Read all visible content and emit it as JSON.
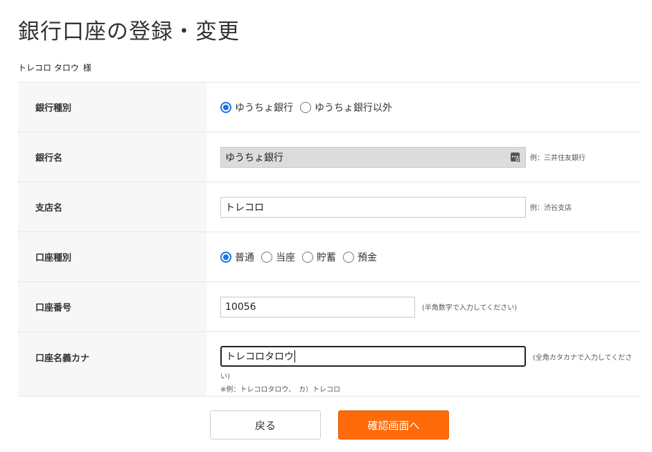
{
  "page": {
    "title": "銀行口座の登録・変更",
    "user_name": "トレコロ タロウ",
    "honorific": "様"
  },
  "form": {
    "bank_type": {
      "label": "銀行種別",
      "options": [
        {
          "label": "ゆうちょ銀行",
          "checked": true
        },
        {
          "label": "ゆうちょ銀行以外",
          "checked": false
        }
      ]
    },
    "bank_name": {
      "label": "銀行名",
      "value": "ゆうちょ銀行",
      "hint": "例：三井住友銀行",
      "icon": "calculator-icon"
    },
    "branch_name": {
      "label": "支店名",
      "value": "トレコロ",
      "hint": "例：渋谷支店"
    },
    "account_type": {
      "label": "口座種別",
      "options": [
        {
          "label": "普通",
          "checked": true
        },
        {
          "label": "当座",
          "checked": false
        },
        {
          "label": "貯蓄",
          "checked": false
        },
        {
          "label": "預金",
          "checked": false
        }
      ]
    },
    "account_number": {
      "label": "口座番号",
      "value": "10056",
      "hint": "(半角数字で入力してください)"
    },
    "account_holder_kana": {
      "label": "口座名義カナ",
      "value": "トレコロタロウ",
      "hint_line1": "(全角カタカナで入力してくださ",
      "hint_line2": "い)",
      "example": "※例：トレコロタロウ、　カ）トレコロ"
    }
  },
  "buttons": {
    "back": "戻る",
    "confirm": "確認画面へ"
  },
  "colors": {
    "accent": "#1a73e8",
    "confirm_button": "#ff6a0a",
    "label_bg": "#f7f7f7"
  }
}
